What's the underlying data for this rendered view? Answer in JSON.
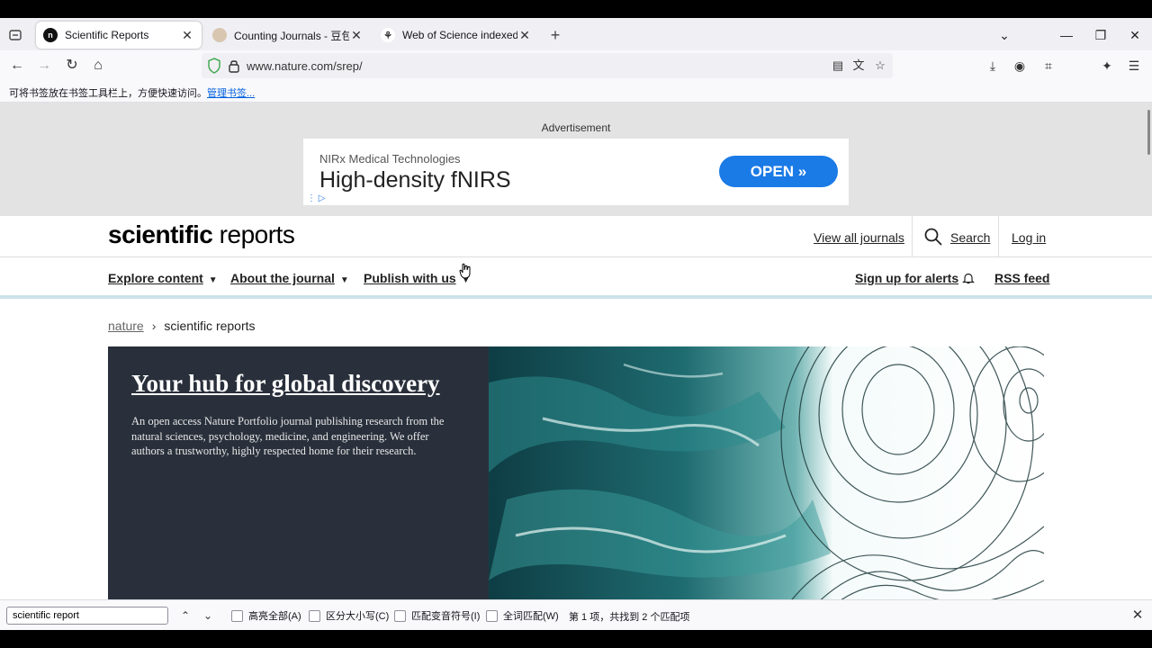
{
  "browser": {
    "tabs": [
      {
        "title": "Scientific Reports",
        "favicon": "nature-n-icon",
        "active": true
      },
      {
        "title": "Counting Journals - 豆包",
        "favicon": "doubao-icon",
        "active": false
      },
      {
        "title": "Web of Science indexed journ",
        "favicon": "clarivate-icon",
        "active": false
      }
    ],
    "url": "www.nature.com/srep/",
    "bookmarks_hint": "可将书签放在书签工具栏上，方便快速访问。",
    "bookmarks_link": "管理书签..."
  },
  "ad": {
    "label": "Advertisement",
    "company": "NIRx Medical Technologies",
    "headline": "High-density fNIRS",
    "cta": "OPEN",
    "cta_color": "#1a7ae6"
  },
  "header": {
    "logo_bold": "scientific",
    "logo_rest": " reports",
    "view_all": "View all journals",
    "search": "Search",
    "login": "Log in"
  },
  "subnav": {
    "explore": "Explore content",
    "about": "About the journal",
    "publish": "Publish with us",
    "alerts": "Sign up for alerts",
    "rss": "RSS feed"
  },
  "breadcrumb": {
    "root": "nature",
    "current": "scientific reports"
  },
  "hero": {
    "title": "Your hub for global discovery",
    "text": "An open access Nature Portfolio journal publishing research from the natural sciences, psychology, medicine, and engineering. We offer authors a trustworthy, highly respected home for their research.",
    "panel_color": "#29303b"
  },
  "findbar": {
    "query": "scientific report",
    "opt_highlight": "高亮全部(A)",
    "opt_case": "区分大小写(C)",
    "opt_diacritics": "匹配变音符号(I)",
    "opt_whole": "全词匹配(W)",
    "status": "第 1 项，共找到 2 个匹配项"
  }
}
